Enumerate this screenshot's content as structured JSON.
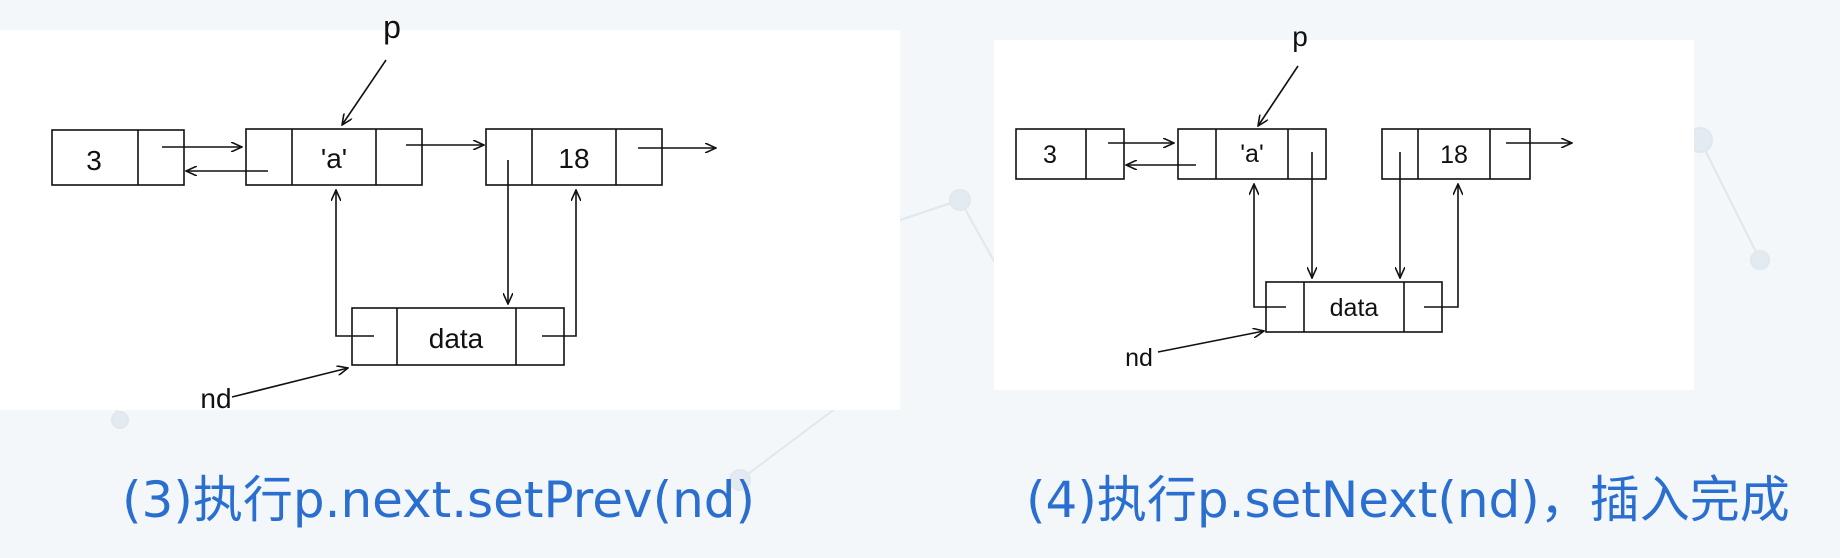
{
  "diagram3": {
    "pointer_p": "p",
    "pointer_nd": "nd",
    "node_left": "3",
    "node_mid": "'a'",
    "node_right": "18",
    "node_new": "data",
    "caption": "(3)执行p.next.setPrev(nd)"
  },
  "diagram4": {
    "pointer_p": "p",
    "pointer_nd": "nd",
    "node_left": "3",
    "node_mid": "'a'",
    "node_right": "18",
    "node_new": "data",
    "caption": "(4)执行p.setNext(nd)，插入完成"
  },
  "colors": {
    "caption": "#2a6fd0",
    "stroke": "#111111",
    "background": "#f3f7fa"
  }
}
